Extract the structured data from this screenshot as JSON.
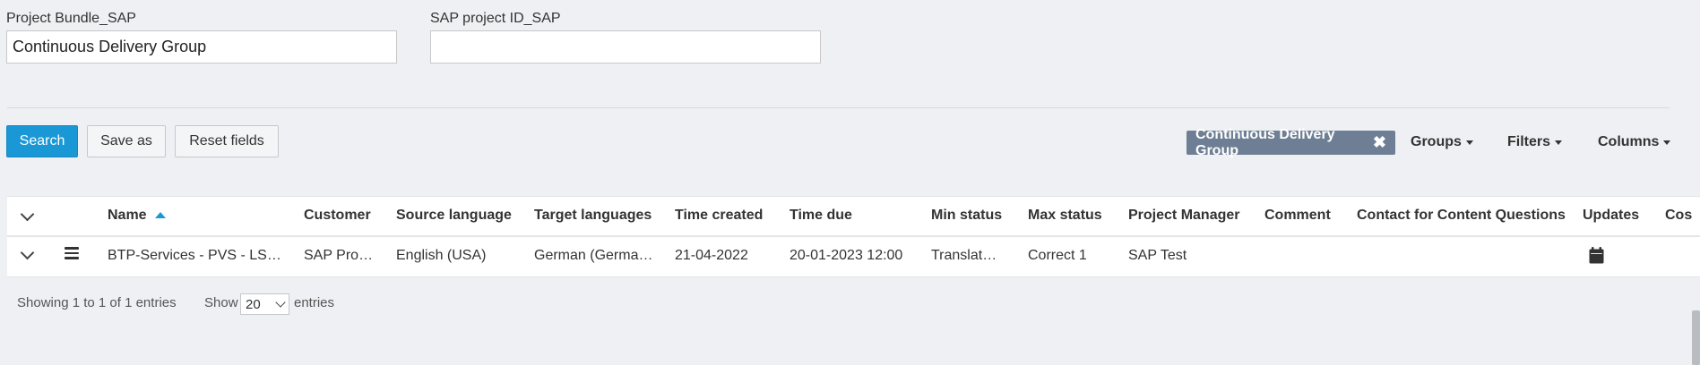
{
  "form": {
    "bundle_label": "Project Bundle_SAP",
    "bundle_value": "Continuous Delivery Group",
    "project_id_label": "SAP project ID_SAP",
    "project_id_value": ""
  },
  "toolbar": {
    "search_label": "Search",
    "save_as_label": "Save as",
    "reset_label": "Reset fields",
    "chip_label": "Continuous Delivery Group",
    "chip_close": "✖",
    "groups_label": "Groups",
    "filters_label": "Filters",
    "columns_label": "Columns"
  },
  "table": {
    "headers": [
      "Name",
      "Customer",
      "Source language",
      "Target languages",
      "Time created",
      "Time due",
      "Min status",
      "Max status",
      "Project Manager",
      "Comment",
      "Contact for Content Questions",
      "Updates",
      "Cos"
    ],
    "sort_column": "Name",
    "sort_direction": "ascending",
    "rows": [
      {
        "name": "BTP-Services - PVS - LS…",
        "customer": "SAP Pro…",
        "source_language": "English (USA)",
        "target_languages": "German (Germa…",
        "time_created": "21-04-2022",
        "time_due": "20-01-2023 12:00",
        "min_status": "Translat…",
        "max_status": "Correct 1",
        "project_manager": "SAP Test",
        "comment": "",
        "contact": "",
        "updates_icon": "calendar-icon"
      }
    ]
  },
  "pagination": {
    "showing": "Showing 1 to 1 of 1 entries",
    "show_label": "Show",
    "page_size": "20",
    "entries_label": "entries"
  },
  "colors": {
    "primary": "#1a98d5",
    "chip": "#6e7f95",
    "background": "#eef0f3"
  }
}
